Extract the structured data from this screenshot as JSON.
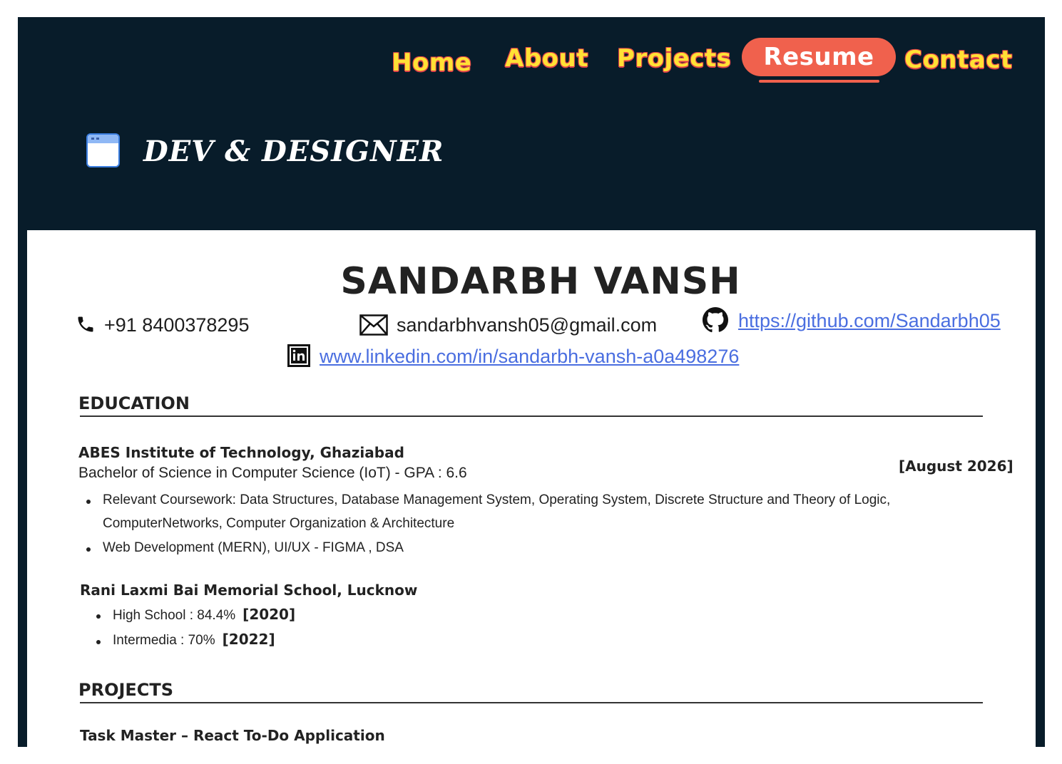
{
  "nav": {
    "home": "Home",
    "about": "About",
    "projects": "Projects",
    "resume": "Resume",
    "contact": "Contact",
    "active": "Resume"
  },
  "brand": {
    "title": "DEV & DESIGNER",
    "icon": "browser-window-icon"
  },
  "resume": {
    "name": "SANDARBH VANSH",
    "phone": "+91 8400378295",
    "email": "sandarbhvansh05@gmail.com",
    "github": "https://github.com/Sandarbh05",
    "linkedin": "www.linkedin.com/in/sandarbh-vansh-a0a498276",
    "icons": {
      "phone": "phone-icon",
      "email": "mail-icon",
      "github": "github-icon",
      "linkedin": "linkedin-icon"
    },
    "education": {
      "title": "EDUCATION",
      "college": {
        "name": "ABES Institute of Technology, Ghaziabad",
        "degree": "Bachelor of Science in Computer Science (IoT)  - GPA : 6.6",
        "date": "[August 2026]",
        "bullets": [
          "Relevant Coursework: Data Structures, Database Management System, Operating System, Discrete Structure and Theory of Logic,",
          "ComputerNetworks, Computer Organization & Architecture",
          "Web Development (MERN),  UI/UX - FIGMA , DSA"
        ]
      },
      "school": {
        "name": "Rani Laxmi Bai Memorial School, Lucknow",
        "items": [
          {
            "label": "High School : 84.4%",
            "year": "[2020]"
          },
          {
            "label": "Intermedia : 70%",
            "year": "[2022]"
          }
        ]
      }
    },
    "projects": {
      "title": "PROJECTS",
      "first": "Task Master – React To-Do Application"
    }
  },
  "colors": {
    "header_bg": "#081c2a",
    "nav_text": "#ffe135",
    "nav_outline": "#e0404a",
    "active_pill": "#f0614d",
    "link": "#4a6ee0"
  }
}
